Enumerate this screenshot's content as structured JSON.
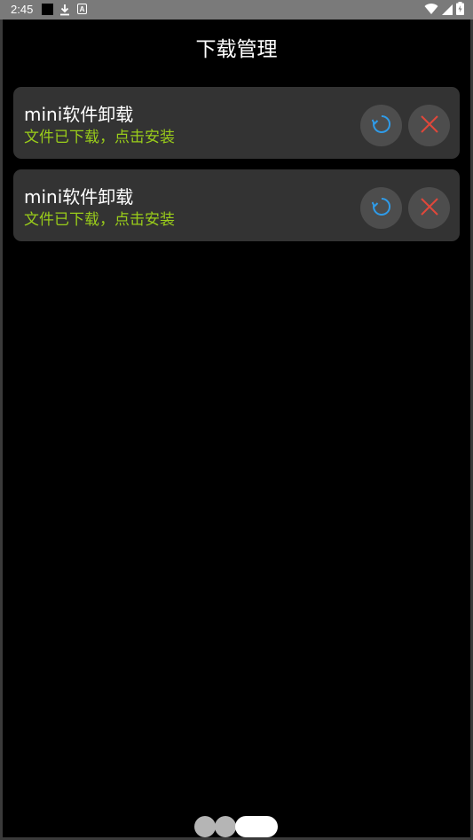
{
  "status_bar": {
    "time": "2:45",
    "notif_letter": "A"
  },
  "page": {
    "title": "下载管理"
  },
  "downloads": [
    {
      "name": "mini软件卸载",
      "status": "文件已下载，点击安装"
    },
    {
      "name": "mini软件卸载",
      "status": "文件已下载，点击安装"
    }
  ],
  "colors": {
    "status_text": "#9acd1a",
    "retry_icon": "#2f9be8",
    "delete_icon": "#e0473a",
    "card_bg": "#333333",
    "button_bg": "#4d4d4d"
  },
  "icons": {
    "retry": "refresh-icon",
    "delete": "close-icon"
  }
}
